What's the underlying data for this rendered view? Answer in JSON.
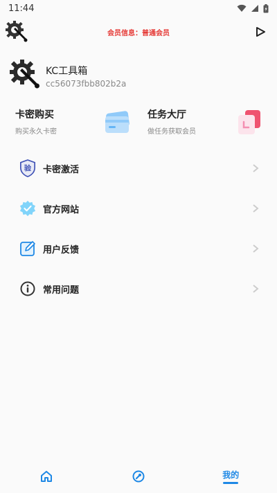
{
  "status_bar": {
    "time": "11:44",
    "icons": [
      "wifi-icon",
      "signal-icon",
      "battery-icon"
    ]
  },
  "top_bar": {
    "member_info": "会员信息：普通会员",
    "logo_icon": "wrench-gear-icon",
    "action_icon": "play-icon"
  },
  "profile": {
    "name": "KC工具箱",
    "id": "cc56073fbb802b2a"
  },
  "cards": [
    {
      "title": "卡密购买",
      "subtitle": "购买永久卡密",
      "icon": "card-icon"
    },
    {
      "title": "任务大厅",
      "subtitle": "做任务获取会员",
      "icon": "task-icon"
    }
  ],
  "menu": [
    {
      "label": "卡密激活",
      "icon": "verify-shield-icon",
      "badge": "验"
    },
    {
      "label": "官方网站",
      "icon": "verified-badge-icon"
    },
    {
      "label": "用户反馈",
      "icon": "edit-icon"
    },
    {
      "label": "常用问题",
      "icon": "info-icon"
    }
  ],
  "bottom_nav": {
    "items": [
      {
        "label": "",
        "icon": "home-icon"
      },
      {
        "label": "",
        "icon": "tools-icon"
      },
      {
        "label": "我的",
        "icon": ""
      }
    ],
    "active_color": "#1e88e5"
  },
  "colors": {
    "member_info": "#e53935",
    "accent": "#1e88e5"
  }
}
